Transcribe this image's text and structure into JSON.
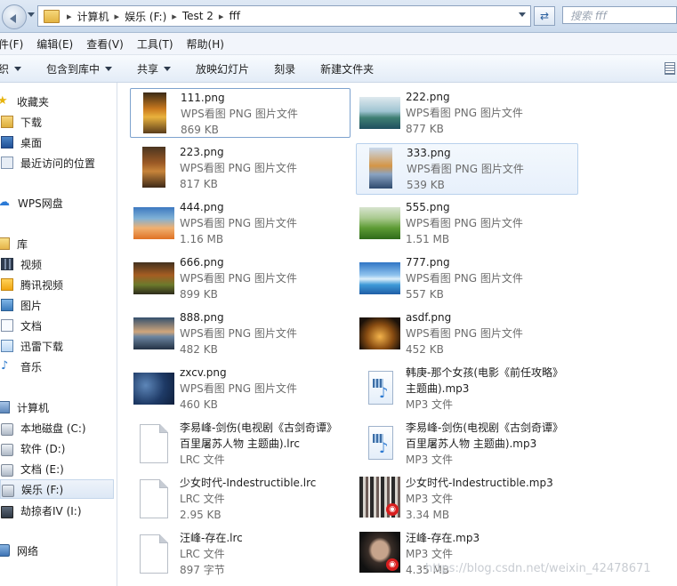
{
  "address": {
    "path": [
      "计算机",
      "娱乐 (F:)",
      "Test 2",
      "fff"
    ],
    "search_placeholder": "搜索 fff"
  },
  "menu": [
    "件(F)",
    "编辑(E)",
    "查看(V)",
    "工具(T)",
    "帮助(H)"
  ],
  "toolbar": [
    "织",
    "包含到库中",
    "共享",
    "放映幻灯片",
    "刻录",
    "新建文件夹"
  ],
  "sidebar": [
    {
      "label": "收藏夹",
      "icon": "star-icon"
    },
    {
      "label": "下载",
      "icon": "download-folder-icon"
    },
    {
      "label": "桌面",
      "icon": "desktop-icon"
    },
    {
      "label": "最近访问的位置",
      "icon": "recent-places-icon"
    },
    {
      "label": "WPS网盘",
      "icon": "cloud-icon"
    },
    {
      "label": "库",
      "icon": "library-icon"
    },
    {
      "label": "视频",
      "icon": "video-icon"
    },
    {
      "label": "腾讯视频",
      "icon": "tencent-video-icon"
    },
    {
      "label": "图片",
      "icon": "pictures-icon"
    },
    {
      "label": "文档",
      "icon": "documents-icon"
    },
    {
      "label": "迅雷下载",
      "icon": "xunlei-icon"
    },
    {
      "label": "音乐",
      "icon": "music-icon"
    },
    {
      "label": "计算机",
      "icon": "computer-icon"
    },
    {
      "label": "本地磁盘 (C:)",
      "icon": "drive-icon"
    },
    {
      "label": "软件 (D:)",
      "icon": "drive-icon"
    },
    {
      "label": "文档 (E:)",
      "icon": "drive-icon"
    },
    {
      "label": "娱乐 (F:)",
      "icon": "drive-icon",
      "selected": true
    },
    {
      "label": "劫掠者IV (I:)",
      "icon": "usb-drive-icon"
    },
    {
      "label": "网络",
      "icon": "network-icon"
    }
  ],
  "files": [
    {
      "name": "111.png",
      "type": "WPS看图 PNG 图片文件",
      "size": "869 KB",
      "thumb": "autumn-tree",
      "state": "selected"
    },
    {
      "name": "222.png",
      "type": "WPS看图 PNG 图片文件",
      "size": "877 KB",
      "thumb": "lake-islands"
    },
    {
      "name": "223.png",
      "type": "WPS看图 PNG 图片文件",
      "size": "817 KB",
      "thumb": "autumn-forest"
    },
    {
      "name": "333.png",
      "type": "WPS看图 PNG 图片文件",
      "size": "539 KB",
      "thumb": "autumn-lake",
      "state": "hover"
    },
    {
      "name": "444.png",
      "type": "WPS看图 PNG 图片文件",
      "size": "1.16 MB",
      "thumb": "orange-gradient"
    },
    {
      "name": "555.png",
      "type": "WPS看图 PNG 图片文件",
      "size": "1.51 MB",
      "thumb": "green-hills"
    },
    {
      "name": "666.png",
      "type": "WPS看图 PNG 图片文件",
      "size": "899 KB",
      "thumb": "fall-valley"
    },
    {
      "name": "777.png",
      "type": "WPS看图 PNG 图片文件",
      "size": "557 KB",
      "thumb": "blue-sea"
    },
    {
      "name": "888.png",
      "type": "WPS看图 PNG 图片文件",
      "size": "482 KB",
      "thumb": "sunset-island"
    },
    {
      "name": "asdf.png",
      "type": "WPS看图 PNG 图片文件",
      "size": "452 KB",
      "thumb": "golden-glow"
    },
    {
      "name": "zxcv.png",
      "type": "WPS看图 PNG 图片文件",
      "size": "460 KB",
      "thumb": "blue-bokeh"
    },
    {
      "name": "韩庚-那个女孩(电影《前任攻略》",
      "name2": "主题曲).mp3",
      "type": "MP3 文件",
      "kind": "mp3"
    },
    {
      "name": "李易峰-剑伤(电视剧《古剑奇谭》",
      "name2": "百里屠苏人物 主题曲).lrc",
      "type": "LRC 文件",
      "kind": "doc"
    },
    {
      "name": "李易峰-剑伤(电视剧《古剑奇谭》",
      "name2": "百里屠苏人物 主题曲).mp3",
      "type": "MP3 文件",
      "kind": "mp3"
    },
    {
      "name": "少女时代-Indestructible.lrc",
      "type": "LRC 文件",
      "size": "2.95 KB",
      "kind": "doc"
    },
    {
      "name": "少女时代-Indestructible.mp3",
      "type": "MP3 文件",
      "size": "3.34 MB",
      "kind": "album",
      "thumb": "group-photo"
    },
    {
      "name": "汪峰-存在.lrc",
      "type": "LRC 文件",
      "size": "897 字节",
      "kind": "doc"
    },
    {
      "name": "汪峰-存在.mp3",
      "type": "MP3 文件",
      "size": "4.35 MB",
      "kind": "album",
      "thumb": "portrait"
    }
  ],
  "watermark": "https://blog.csdn.net/weixin_42478671"
}
